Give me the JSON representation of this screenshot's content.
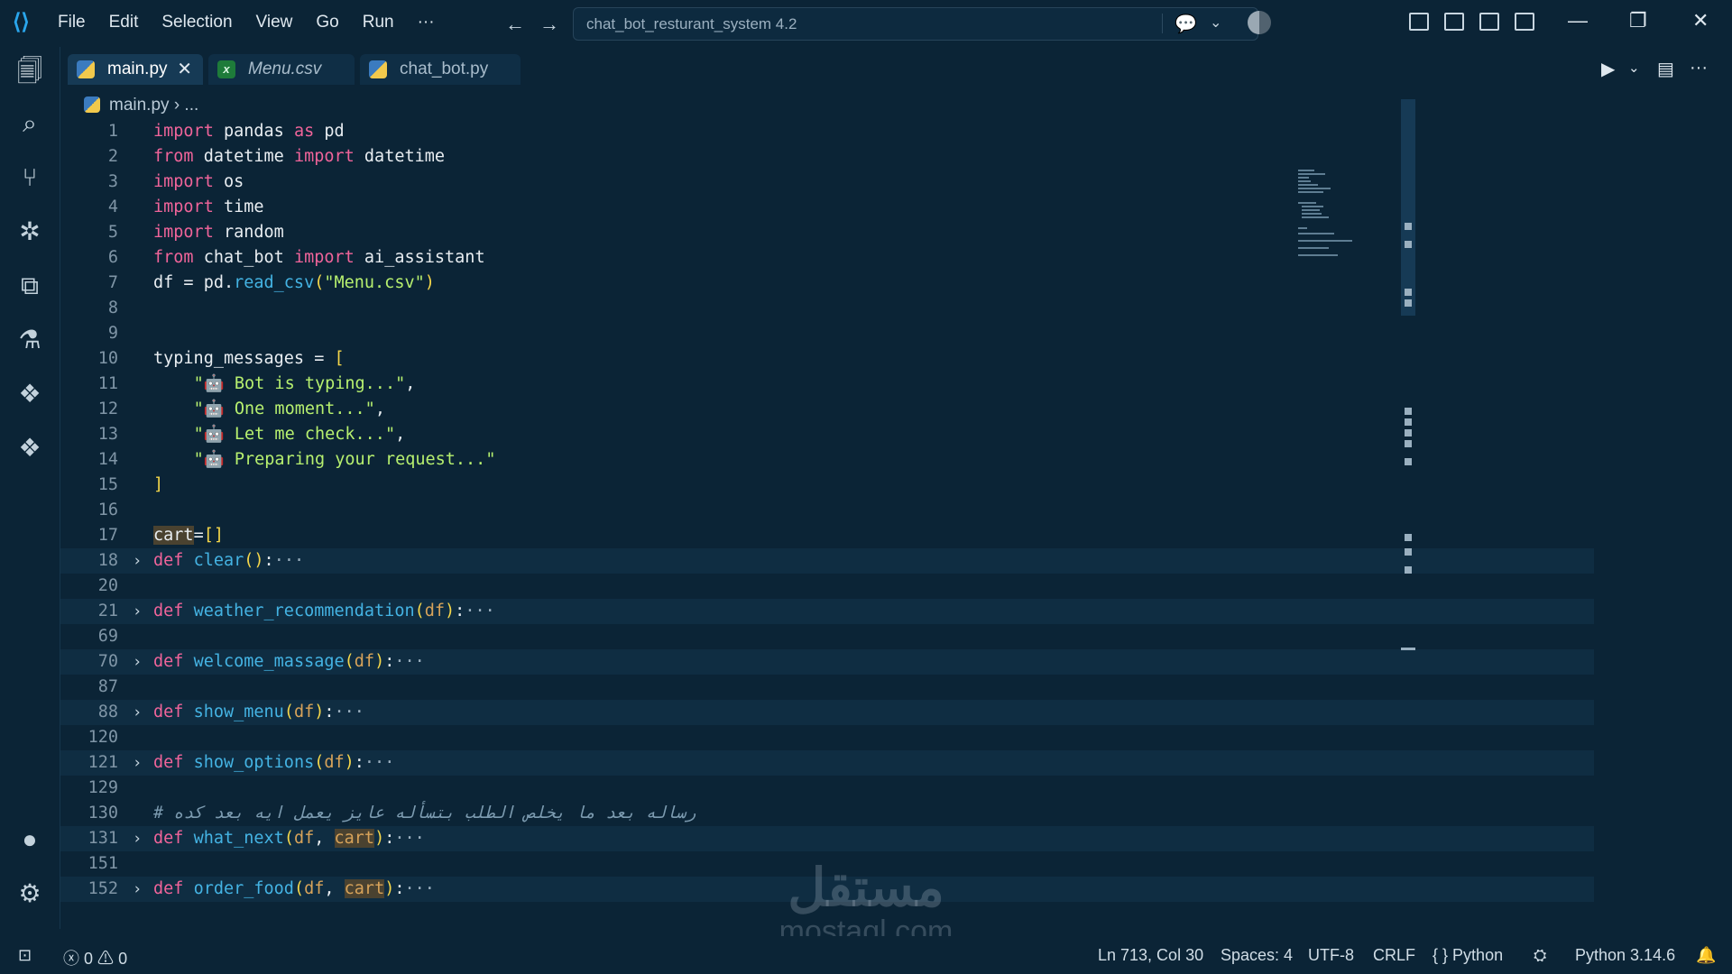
{
  "menu": {
    "items": [
      "File",
      "Edit",
      "Selection",
      "View",
      "Go",
      "Run",
      "···"
    ]
  },
  "search": {
    "text": "chat_bot_resturant_system 4.2"
  },
  "tabs": [
    {
      "label": "main.py",
      "icon": "python-icon",
      "active": true,
      "italic": false
    },
    {
      "label": "Menu.csv",
      "icon": "csv-icon",
      "active": false,
      "italic": true
    },
    {
      "label": "chat_bot.py",
      "icon": "python-icon",
      "active": false,
      "italic": false
    }
  ],
  "breadcrumb": {
    "file": "main.py",
    "rest": "..."
  },
  "code": {
    "lines": [
      {
        "n": "1",
        "text": "import pandas as pd"
      },
      {
        "n": "2",
        "text": "from datetime import datetime"
      },
      {
        "n": "3",
        "text": "import os"
      },
      {
        "n": "4",
        "text": "import time"
      },
      {
        "n": "5",
        "text": "import random"
      },
      {
        "n": "6",
        "text": "from chat_bot import ai_assistant"
      },
      {
        "n": "7",
        "text": "df = pd.read_csv(\"Menu.csv\")"
      },
      {
        "n": "8",
        "text": ""
      },
      {
        "n": "9",
        "text": ""
      },
      {
        "n": "10",
        "text": "typing_messages = ["
      },
      {
        "n": "11",
        "text": "    \"🤖 Bot is typing...\","
      },
      {
        "n": "12",
        "text": "    \"🤖 One moment...\","
      },
      {
        "n": "13",
        "text": "    \"🤖 Let me check...\","
      },
      {
        "n": "14",
        "text": "    \"🤖 Preparing your request...\""
      },
      {
        "n": "15",
        "text": "]"
      },
      {
        "n": "16",
        "text": ""
      },
      {
        "n": "17",
        "text": "cart=[]"
      },
      {
        "n": "18",
        "text": "def clear():···"
      },
      {
        "n": "20",
        "text": ""
      },
      {
        "n": "21",
        "text": "def weather_recommendation(df):···"
      },
      {
        "n": "69",
        "text": ""
      },
      {
        "n": "70",
        "text": "def welcome_massage(df):···"
      },
      {
        "n": "87",
        "text": ""
      },
      {
        "n": "88",
        "text": "def show_menu(df):···"
      },
      {
        "n": "120",
        "text": ""
      },
      {
        "n": "121",
        "text": "def show_options(df):···"
      },
      {
        "n": "129",
        "text": ""
      },
      {
        "n": "130",
        "text": "# رساله بعد ما يخلص الطلب بتسأله عايز يعمل ايه بعد كده"
      },
      {
        "n": "131",
        "text": "def what_next(df, cart):···"
      },
      {
        "n": "151",
        "text": ""
      },
      {
        "n": "152",
        "text": "def order_food(df, cart):···"
      }
    ]
  },
  "status": {
    "errors": "0",
    "warnings": "0",
    "position": "Ln 713, Col 30",
    "spaces": "Spaces: 4",
    "encoding": "UTF-8",
    "eol": "CRLF",
    "language": "Python",
    "interpreter": "Python 3.14.6"
  },
  "watermark": {
    "line1": "مستقل",
    "line2": "mostaql.com"
  },
  "colors": {
    "background": "#0b2436",
    "keyword": "#f0649a",
    "function": "#44b3e3",
    "string": "#b7f06f",
    "bracket": "#f5d74a"
  }
}
